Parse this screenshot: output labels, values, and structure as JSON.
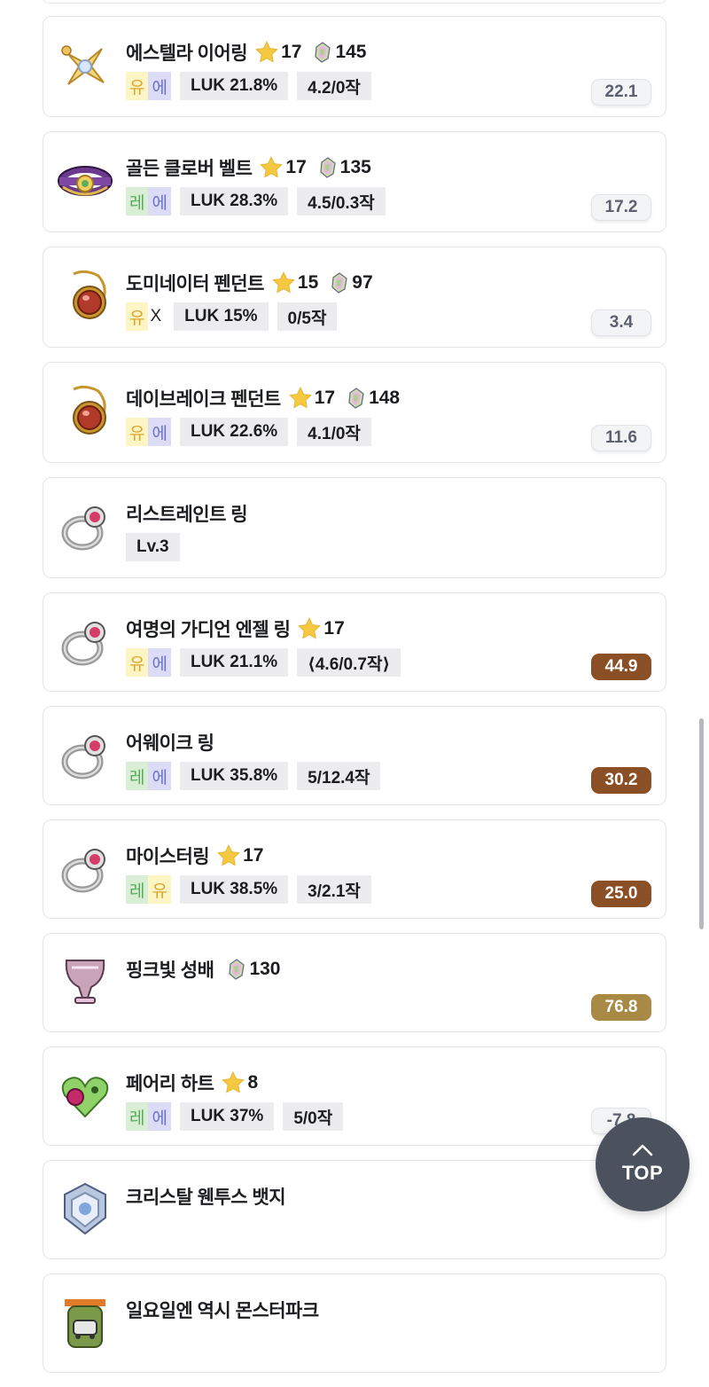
{
  "items": [
    {
      "name": "에스텔라 이어링",
      "stars": "17",
      "soul": "145",
      "pot": [
        {
          "t": "유",
          "c": "yu"
        },
        {
          "t": "에",
          "c": "eu"
        }
      ],
      "stat": "LUK 21.8%",
      "scroll": "4.2/0작",
      "score": "22.1",
      "score_style": "plain",
      "icon": "earring-icon"
    },
    {
      "name": "골든 클로버 벨트",
      "stars": "17",
      "soul": "135",
      "pot": [
        {
          "t": "레",
          "c": "re"
        },
        {
          "t": "에",
          "c": "eu"
        }
      ],
      "stat": "LUK 28.3%",
      "scroll": "4.5/0.3작",
      "score": "17.2",
      "score_style": "plain",
      "icon": "belt-icon"
    },
    {
      "name": "도미네이터 펜던트",
      "stars": "15",
      "soul": "97",
      "pot": [
        {
          "t": "유",
          "c": "yu"
        },
        {
          "t": "X",
          "c": "x"
        }
      ],
      "stat": "LUK 15%",
      "scroll": "0/5작",
      "score": "3.4",
      "score_style": "plain",
      "icon": "pendant-icon"
    },
    {
      "name": "데이브레이크 펜던트",
      "stars": "17",
      "soul": "148",
      "pot": [
        {
          "t": "유",
          "c": "yu"
        },
        {
          "t": "에",
          "c": "eu"
        }
      ],
      "stat": "LUK 22.6%",
      "scroll": "4.1/0작",
      "score": "11.6",
      "score_style": "plain",
      "icon": "pendant-icon"
    },
    {
      "name": "리스트레인트 링",
      "level": "Lv.3",
      "icon": "ring-icon"
    },
    {
      "name": "여명의 가디언 엔젤 링",
      "stars": "17",
      "pot": [
        {
          "t": "유",
          "c": "yu"
        },
        {
          "t": "에",
          "c": "eu"
        }
      ],
      "stat": "LUK 21.1%",
      "scroll": "⟨4.6/0.7작⟩",
      "score": "44.9",
      "score_style": "brown",
      "icon": "ring-icon"
    },
    {
      "name": "어웨이크 링",
      "pot": [
        {
          "t": "레",
          "c": "re"
        },
        {
          "t": "에",
          "c": "eu"
        }
      ],
      "stat": "LUK 35.8%",
      "scroll": "5/12.4작",
      "score": "30.2",
      "score_style": "brown",
      "icon": "ring-icon"
    },
    {
      "name": "마이스터링",
      "stars": "17",
      "pot": [
        {
          "t": "레",
          "c": "re"
        },
        {
          "t": "유",
          "c": "yu"
        }
      ],
      "stat": "LUK 38.5%",
      "scroll": "3/2.1작",
      "score": "25.0",
      "score_style": "brown",
      "icon": "ring-icon"
    },
    {
      "name": "핑크빛 성배",
      "soul": "130",
      "score": "76.8",
      "score_style": "olive",
      "icon": "chalice-icon"
    },
    {
      "name": "페어리 하트",
      "stars": "8",
      "pot": [
        {
          "t": "레",
          "c": "re"
        },
        {
          "t": "에",
          "c": "eu"
        }
      ],
      "stat": "LUK 37%",
      "scroll": "5/0작",
      "score": "-7.8",
      "score_style": "plain",
      "icon": "heart-icon"
    },
    {
      "name": "크리스탈 웬투스 뱃지",
      "icon": "badge-icon"
    },
    {
      "name": "일요일엔 역시 몬스터파크",
      "icon": "medal-icon"
    }
  ],
  "top_button": {
    "label": "TOP"
  },
  "colors": {
    "score_brown": "#8a4f24",
    "score_olive": "#a88a45",
    "top_button": "#4b525d"
  }
}
